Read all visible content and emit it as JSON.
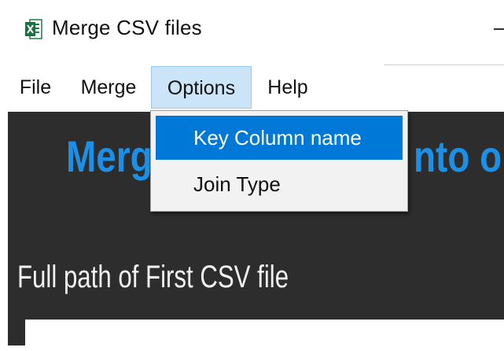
{
  "window": {
    "title": "Merge CSV files",
    "icon": "excel-icon",
    "minimize": "minimize-icon"
  },
  "menubar": {
    "items": [
      {
        "label": "File"
      },
      {
        "label": "Merge"
      },
      {
        "label": "Options",
        "state": "open"
      },
      {
        "label": "Help"
      }
    ]
  },
  "options_menu": {
    "items": [
      {
        "label": "Key Column name",
        "state": "highlighted"
      },
      {
        "label": "Join Type"
      }
    ]
  },
  "main": {
    "heading_left": "Merg",
    "heading_right": "nto o",
    "first_csv_label": "Full path of First CSV file",
    "first_csv_value": ""
  },
  "colors": {
    "accent": "#1c8fe6",
    "panel_background": "#2d2d2d",
    "highlight": "#0078d7",
    "menu_open": "#cce4f7"
  }
}
